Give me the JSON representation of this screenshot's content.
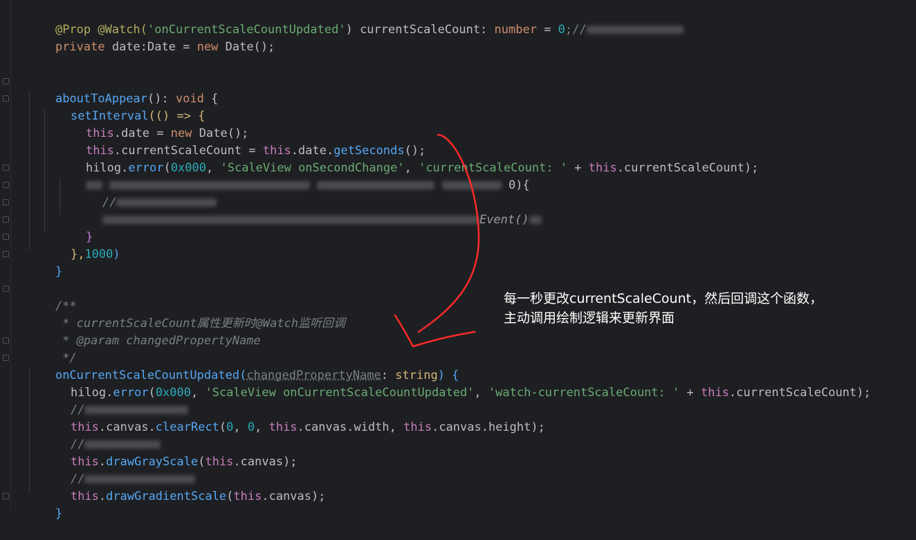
{
  "code": {
    "l1_deco": "@Prop @Watch(",
    "l1_str": "'onCurrentScaleCountUpdated'",
    "l1_rest": ") currentScaleCount: ",
    "l1_type": "number",
    "l1_eq": " = ",
    "l1_num": "0",
    "l1_end": ";//",
    "l2_kw": "private ",
    "l2_id": "date:",
    "l2_type": "Date",
    "l2_eq": " = ",
    "l2_new": "new ",
    "l2_ctor": "Date",
    "l2_end": "();",
    "l5_fn": "aboutToAppear",
    "l5_mid": "(): ",
    "l5_void": "void",
    "l5_brace": " {",
    "l6_fn": "setInterval",
    "l6_rest": "(() => {",
    "l7_this": "this",
    "l7_mid": ".date = ",
    "l7_new": "new ",
    "l7_ctor": "Date",
    "l7_end": "();",
    "l8_this": "this",
    "l8_mid": ".currentScaleCount = ",
    "l8_this2": "this",
    "l8_mid2": ".date.",
    "l8_fn": "getSeconds",
    "l8_end": "();",
    "l9_obj": "hilog.",
    "l9_fn": "error",
    "l9_p": "(",
    "l9_num": "0x000",
    "l9_c1": ", ",
    "l9_s1": "'ScaleView onSecondChange'",
    "l9_c2": ", ",
    "l9_s2": "'currentScaleCount: '",
    "l9_plus": " + ",
    "l9_this": "this",
    "l9_end": ".currentScaleCount);",
    "l10_tail": "0){",
    "l11_cm": "//",
    "l12_tail": "Event()",
    "l13_brace": "}",
    "l14_a": "},",
    "l14_num": "1000",
    "l14_b": ")",
    "l15_brace": "}",
    "l17_cm": "/**",
    "l18_cm": " * currentScaleCount属性更新时@Watch监听回调",
    "l19_cm": " * @param changedPropertyName",
    "l20_cm": " */",
    "l21_fn": "onCurrentScaleCountUpdated",
    "l21_p": "(",
    "l21_param": "changedPropertyName",
    "l21_colon": ": ",
    "l21_type": "string",
    "l21_end": ") {",
    "l22_obj": "hilog.",
    "l22_fn": "error",
    "l22_p": "(",
    "l22_num": "0x000",
    "l22_c1": ", ",
    "l22_s1": "'ScaleView onCurrentScaleCountUpdated'",
    "l22_c2": ", ",
    "l22_s2": "'watch-currentScaleCount: '",
    "l22_plus": " + ",
    "l22_this": "this",
    "l22_end": ".currentScaleCount);",
    "l23_cm": "//",
    "l24_this": "this",
    "l24_mid": ".canvas.",
    "l24_fn": "clearRect",
    "l24_p": "(",
    "l24_n1": "0",
    "l24_c": ", ",
    "l24_n2": "0",
    "l24_c2": ", ",
    "l24_this2": "this",
    "l24_w": ".canvas.width, ",
    "l24_this3": "this",
    "l24_end": ".canvas.height);",
    "l25_cm": "//",
    "l26_this": "this",
    "l26_dot": ".",
    "l26_fn": "drawGrayScale",
    "l26_p": "(",
    "l26_this2": "this",
    "l26_end": ".canvas);",
    "l27_cm": "//",
    "l28_this": "this",
    "l28_dot": ".",
    "l28_fn": "drawGradientScale",
    "l28_p": "(",
    "l28_this2": "this",
    "l28_end": ".canvas);",
    "l29_brace": "}"
  },
  "annotation": {
    "line1": "每一秒更改currentScaleCount，然后回调这个函数，",
    "line2": "主动调用绘制逻辑来更新界面"
  },
  "colors": {
    "background": "#1e1f22",
    "keyword": "#cf8e6d",
    "string": "#6aab73",
    "number": "#2aacb8",
    "function": "#56a8f5",
    "this": "#c77dbb",
    "arrow": "#ff2a2a"
  }
}
